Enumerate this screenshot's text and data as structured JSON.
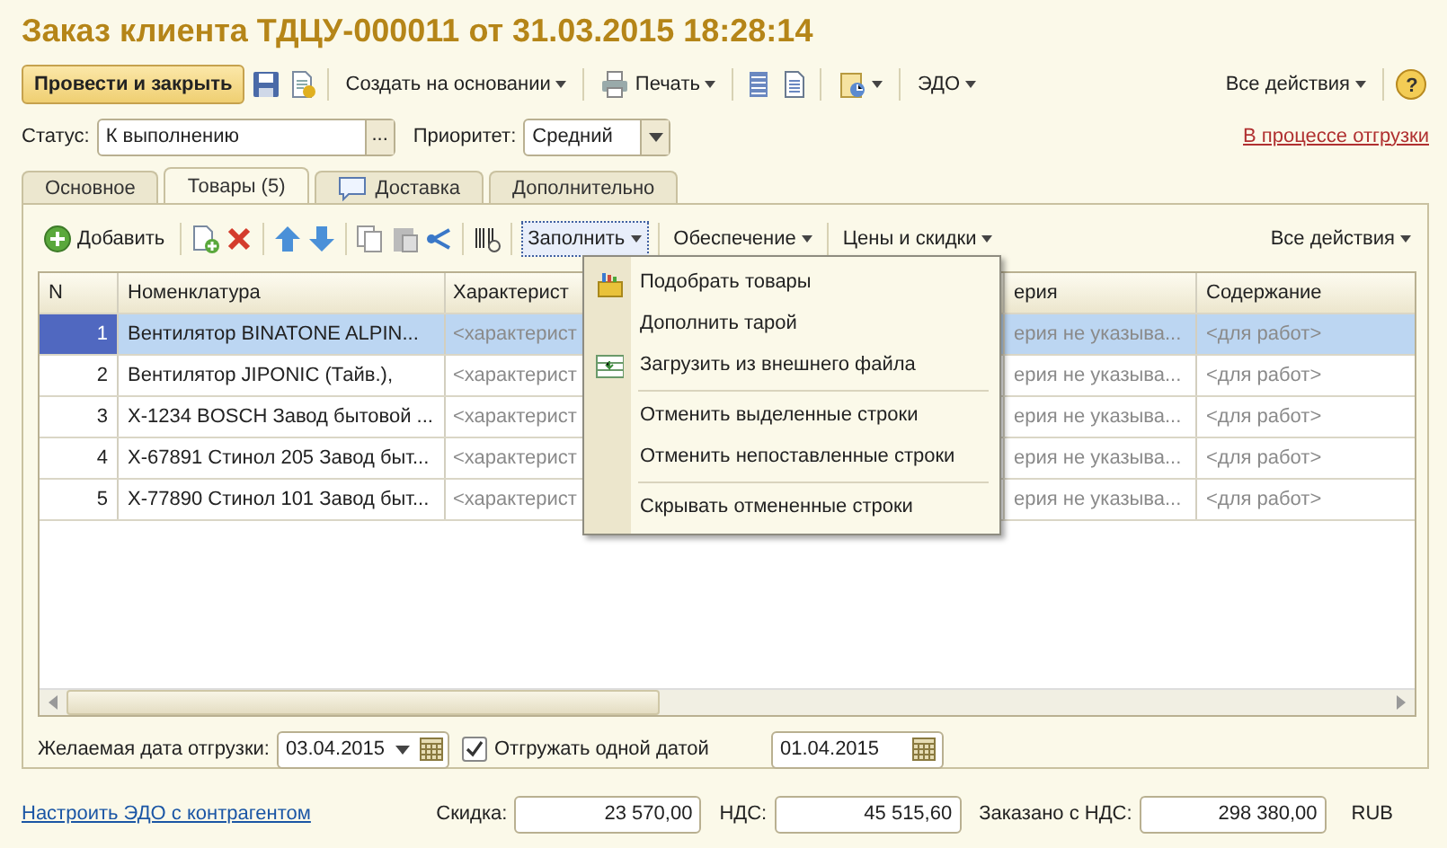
{
  "window": {
    "title": "Заказ клиента ТДЦУ-000011 от 31.03.2015 18:28:14"
  },
  "command_bar": {
    "post_and_close": "Провести и закрыть",
    "create_based_on": "Создать на основании",
    "print": "Печать",
    "edo": "ЭДО",
    "all_actions": "Все действия",
    "help": "?"
  },
  "header": {
    "status_label": "Статус:",
    "status_value": "К выполнению",
    "status_button": "...",
    "priority_label": "Приоритет:",
    "priority_value": "Средний",
    "shipment_link": "В процессе отгрузки"
  },
  "tabs": [
    {
      "label": "Основное",
      "selected": false
    },
    {
      "label": "Товары (5)",
      "selected": true
    },
    {
      "label": "Доставка",
      "selected": false
    },
    {
      "label": "Дополнительно",
      "selected": false
    }
  ],
  "goods_toolbar": {
    "add": "Добавить",
    "fill": "Заполнить",
    "fill_open": true,
    "supply": "Обеспечение",
    "prices": "Цены и скидки",
    "all_actions": "Все действия"
  },
  "fill_menu": [
    {
      "label": "Подобрать товары",
      "divider_before": false
    },
    {
      "label": "Дополнить тарой",
      "divider_before": false
    },
    {
      "label": "Загрузить из внешнего файла",
      "divider_before": false
    },
    {
      "label": "Отменить выделенные строки",
      "divider_before": true
    },
    {
      "label": "Отменить непоставленные строки",
      "divider_before": false
    },
    {
      "label": "Скрывать отмененные строки",
      "divider_before": true
    }
  ],
  "table": {
    "columns": [
      "N",
      "Номенклатура",
      "Характерист",
      "ерия",
      "Содержание"
    ],
    "rows": [
      {
        "cells": [
          "1",
          "Вентилятор BINATONE ALPIN...",
          "<характерист",
          "ерия не указыва...",
          "<для работ>"
        ],
        "selected": true
      },
      {
        "cells": [
          "2",
          "Вентилятор JIPONIC (Тайв.),",
          "<характерист",
          "ерия не указыва...",
          "<для работ>"
        ],
        "selected": false
      },
      {
        "cells": [
          "3",
          "X-1234 BOSCH Завод бытовой ...",
          "<характерист",
          "ерия не указыва...",
          "<для работ>"
        ],
        "selected": false
      },
      {
        "cells": [
          "4",
          "X-67891 Стинол 205 Завод быт...",
          "<характерист",
          "ерия не указыва...",
          "<для работ>"
        ],
        "selected": false
      },
      {
        "cells": [
          "5",
          "X-77890 Стинол 101 Завод быт...",
          "<характерист",
          "ерия не указыва...",
          "<для работ>"
        ],
        "selected": false
      }
    ]
  },
  "shipment": {
    "date_label": "Желаемая дата отгрузки:",
    "date_value": "03.04.2015",
    "single_date_label": "Отгружать одной датой",
    "single_date_checked": true,
    "single_date_value": "01.04.2015"
  },
  "footer": {
    "edo_link": "Настроить ЭДО с контрагентом",
    "discount_label": "Скидка:",
    "discount": "23 570,00",
    "vat_label": "НДС:",
    "vat": "45 515,60",
    "total_label": "Заказано с НДС:",
    "total": "298 380,00",
    "currency": "RUB"
  }
}
